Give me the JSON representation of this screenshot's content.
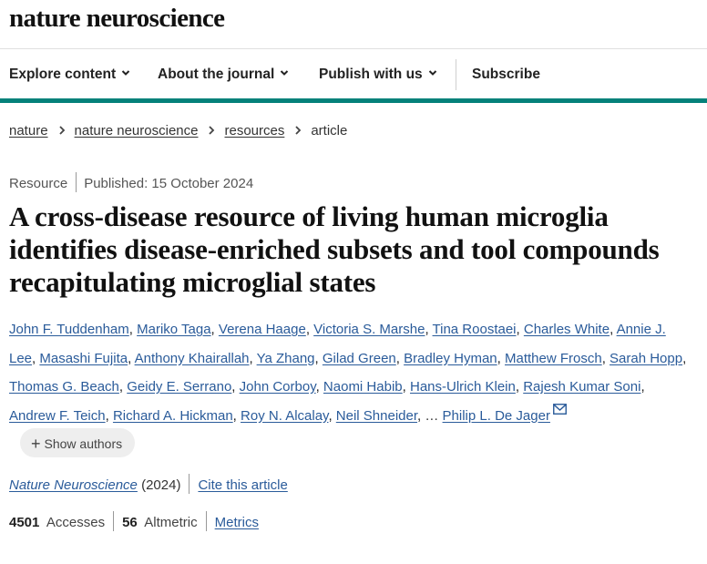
{
  "header": {
    "brand": "nature neuroscience",
    "nav": [
      {
        "label": "Explore content",
        "has_dropdown": true
      },
      {
        "label": "About the journal",
        "has_dropdown": true
      },
      {
        "label": "Publish with us",
        "has_dropdown": true
      },
      {
        "label": "Subscribe",
        "has_dropdown": false
      }
    ],
    "accent_color": "#04817a"
  },
  "breadcrumb": [
    "nature",
    "nature neuroscience",
    "resources",
    "article"
  ],
  "article": {
    "type": "Resource",
    "published": "Published: 15 October 2024",
    "title": "A cross-disease resource of living human microglia identifies disease-enriched subsets and tool compounds recapitulating microglial states",
    "authors": [
      "John F. Tuddenham",
      "Mariko Taga",
      "Verena Haage",
      "Victoria S. Marshe",
      "Tina Roostaei",
      "Charles White",
      "Annie J. Lee",
      "Masashi Fujita",
      "Anthony Khairallah",
      "Ya Zhang",
      "Gilad Green",
      "Bradley Hyman",
      "Matthew Frosch",
      "Sarah Hopp",
      "Thomas G. Beach",
      "Geidy E. Serrano",
      "John Corboy",
      "Naomi Habib",
      "Hans-Ulrich Klein",
      "Rajesh Kumar Soni",
      "Andrew F. Teich",
      "Richard A. Hickman",
      "Roy N. Alcalay",
      "Neil Shneider"
    ],
    "ellipsis": "…",
    "last_author": "Philip L. De Jager",
    "show_authors_label": "Show authors",
    "journal_name": "Nature Neuroscience",
    "year": "(2024)",
    "cite_label": "Cite this article",
    "accesses_value": "4501",
    "accesses_label": "Accesses",
    "altmetric_value": "56",
    "altmetric_label": "Altmetric",
    "metrics_label": "Metrics"
  }
}
